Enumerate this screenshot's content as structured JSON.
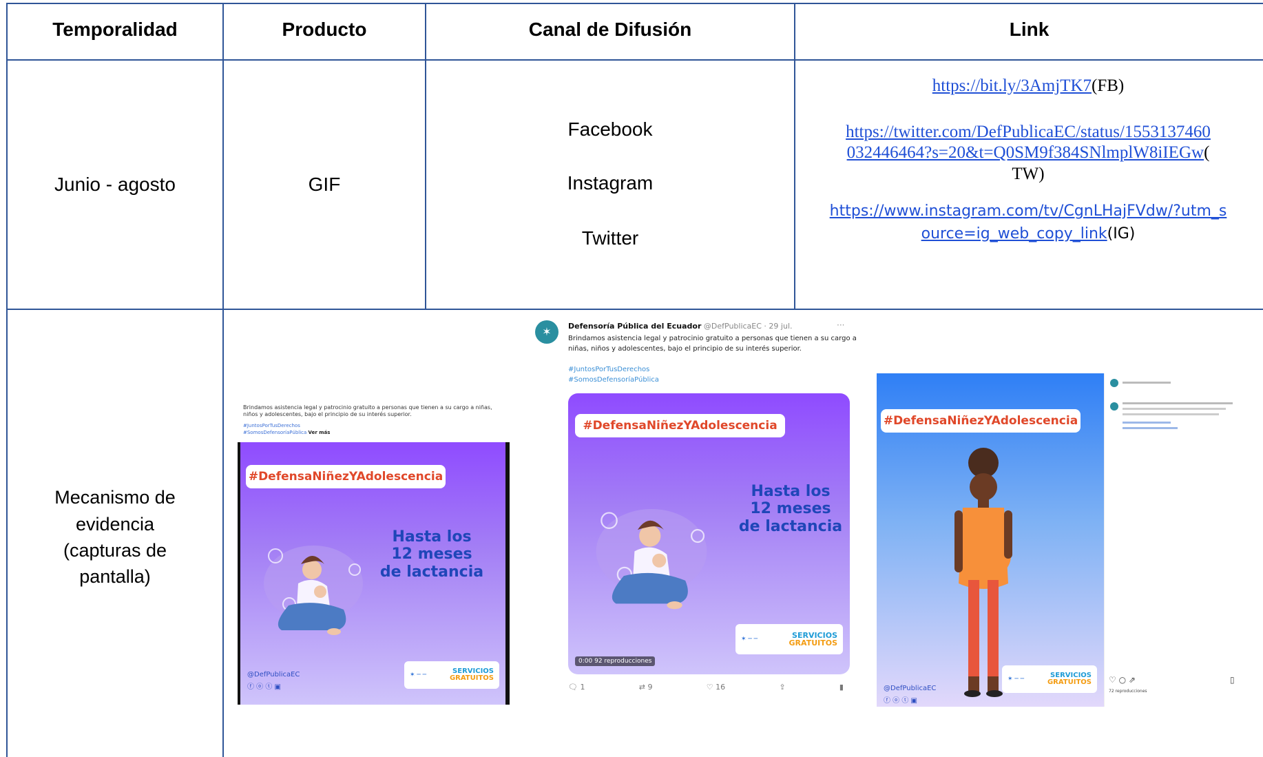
{
  "table": {
    "headers": [
      "Temporalidad",
      "Producto",
      "Canal de Difusión",
      "Link"
    ],
    "row1": {
      "temporalidad": "Junio - agosto",
      "producto": "GIF",
      "canales": [
        "Facebook",
        "Instagram",
        "Twitter"
      ],
      "links": {
        "fb_url": "https://bit.ly/3AmjTK7",
        "fb_suffix": "(FB)",
        "tw_url_line1": "https://twitter.com/DefPublicaEC/status/1553137460",
        "tw_url_line2": "032446464?s=20&t=Q0SM9f384SNlmplW8iIEGw",
        "tw_suffix_a": "(",
        "tw_suffix_b": "TW)",
        "ig_url_line1": "https://www.instagram.com/tv/CgnLHajFVdw/?utm_s",
        "ig_url_line2": "ource=ig_web_copy_link",
        "ig_suffix": "(IG)"
      }
    },
    "row2": {
      "label": "Mecanismo de evidencia (capturas de pantalla)",
      "label_lines": [
        "Mecanismo de",
        "evidencia",
        "(capturas de",
        "pantalla)"
      ]
    }
  },
  "screenshots": {
    "facebook": {
      "caption": "Brindamos asistencia legal y patrocinio gratuito a personas que tienen a su cargo a niñas, niños y adolescentes, bajo el principio de su interés superior.",
      "hashtags": [
        "#JuntosPorTusDerechos",
        "#SomosDefensoríaPública"
      ],
      "see_more": "Ver más",
      "hashtag_banner": "#DefensaNiñezYAdolescencia",
      "headline": [
        "Hasta los",
        "12 meses",
        "de lactancia"
      ],
      "badge": [
        "SERVICIOS",
        "GRATUITOS"
      ],
      "handle": "@DefPublicaEC"
    },
    "twitter": {
      "account": "Defensoría Pública del Ecuador",
      "handle_date": "@DefPublicaEC · 29 jul.",
      "text": "Brindamos asistencia legal y patrocinio gratuito a personas que tienen a su cargo a niñas, niños y adolescentes, bajo el principio de su interés superior.",
      "hashtags": [
        "#JuntosPorTusDerechos",
        "#SomosDefensoríaPública"
      ],
      "hashtag_banner": "#DefensaNiñezYAdolescencia",
      "headline": [
        "Hasta los",
        "12 meses",
        "de lactancia"
      ],
      "badge": [
        "SERVICIOS",
        "GRATUITOS"
      ],
      "video_time": "0:00",
      "views": "92 reproducciones",
      "counts": {
        "replies": "1",
        "retweets": "9",
        "likes": "16"
      }
    },
    "instagram": {
      "hashtag_banner": "#DefensaNiñezYAdolescencia",
      "badge": [
        "SERVICIOS",
        "GRATUITOS"
      ],
      "handle": "@DefPublicaEC",
      "views": "72 reproducciones"
    }
  },
  "colors": {
    "grid": "#2f5597",
    "link": "#1f4fd6",
    "banner_text": "#e0482a",
    "headline": "#1f46b8"
  }
}
